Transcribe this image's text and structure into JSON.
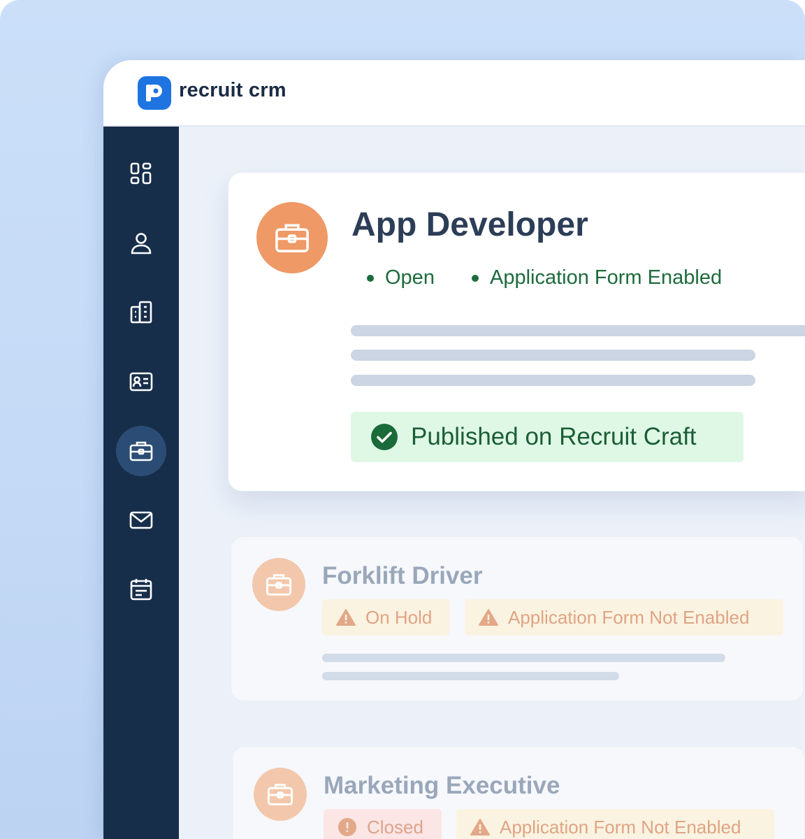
{
  "app": {
    "name": "recruit crm"
  },
  "sidebar": {
    "items": [
      {
        "icon": "dashboard-icon",
        "active": false
      },
      {
        "icon": "candidate-icon",
        "active": false
      },
      {
        "icon": "company-icon",
        "active": false
      },
      {
        "icon": "contact-card-icon",
        "active": false
      },
      {
        "icon": "briefcase-icon",
        "active": true
      },
      {
        "icon": "mail-icon",
        "active": false
      },
      {
        "icon": "calendar-icon",
        "active": false
      }
    ]
  },
  "jobs": [
    {
      "title": "App Developer",
      "statuses": [
        "Open",
        "Application Form Enabled"
      ],
      "published": "Published on Recruit Craft"
    },
    {
      "title": "Forklift Driver",
      "badges": [
        "On Hold",
        "Application Form Not Enabled"
      ]
    },
    {
      "title": "Marketing Executive",
      "badges": [
        "Closed",
        "Application Form Not Enabled"
      ]
    }
  ],
  "colors": {
    "brand_blue": "#1e74e0",
    "sidebar_bg": "#172e4b",
    "job_avatar": "#ee9966",
    "status_green": "#1d6b3c",
    "published_bg": "#dff8e6"
  }
}
